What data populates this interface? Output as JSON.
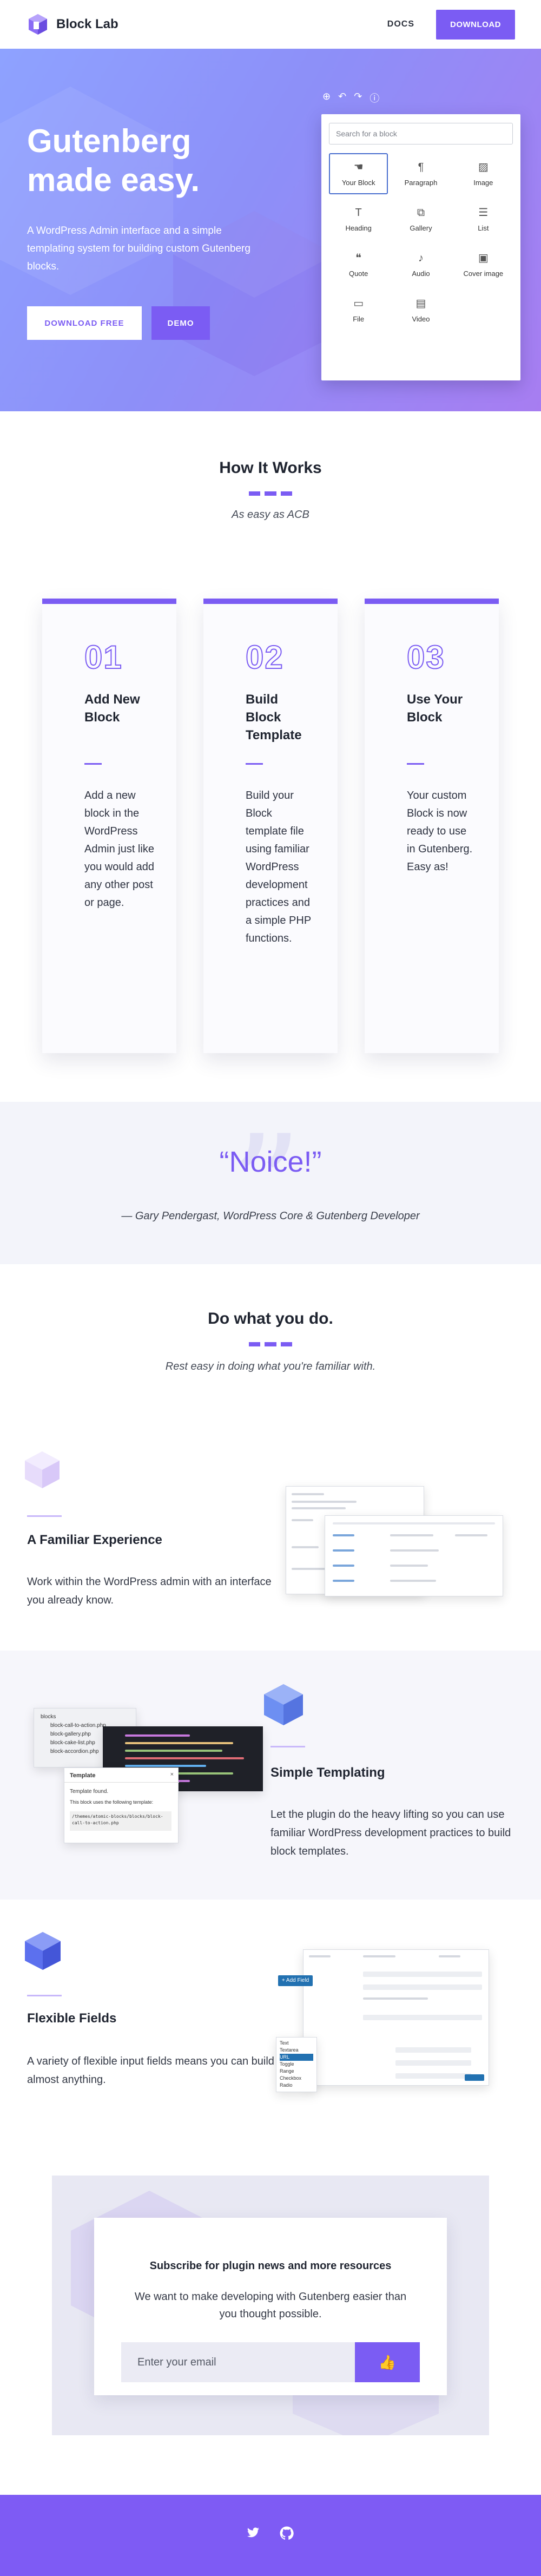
{
  "header": {
    "brand": "Block Lab",
    "nav_docs": "DOCS",
    "nav_download": "DOWNLOAD"
  },
  "hero": {
    "title": "Gutenberg made easy.",
    "subtitle": "A WordPress Admin interface and a simple templating system for building custom Gutenberg blocks.",
    "download_free": "DOWNLOAD FREE",
    "demo": "DEMO",
    "inserter": {
      "search_placeholder": "Search for a block",
      "blocks": [
        {
          "label": "Your Block",
          "icon": "hand-icon"
        },
        {
          "label": "Paragraph",
          "icon": "paragraph-icon"
        },
        {
          "label": "Image",
          "icon": "image-icon"
        },
        {
          "label": "Heading",
          "icon": "heading-icon"
        },
        {
          "label": "Gallery",
          "icon": "gallery-icon"
        },
        {
          "label": "List",
          "icon": "list-icon"
        },
        {
          "label": "Quote",
          "icon": "quote-icon"
        },
        {
          "label": "Audio",
          "icon": "audio-icon"
        },
        {
          "label": "Cover image",
          "icon": "cover-image-icon"
        },
        {
          "label": "File",
          "icon": "file-icon"
        },
        {
          "label": "Video",
          "icon": "video-icon"
        }
      ]
    }
  },
  "how": {
    "title": "How It Works",
    "subtitle": "As easy as ACB",
    "steps": [
      {
        "number": "01",
        "title": "Add New Block",
        "body": "Add a new block in the WordPress Admin just like you would add any other post or page."
      },
      {
        "number": "02",
        "title": "Build Block Template",
        "body": "Build your Block template file using familiar WordPress development practices and a simple PHP functions."
      },
      {
        "number": "03",
        "title": "Use Your Block",
        "body": "Your custom Block is now ready to use in Gutenberg. Easy as!"
      }
    ]
  },
  "quote": {
    "text": "“Noice!”",
    "author": "— Gary Pendergast, WordPress Core & Gutenberg Developer"
  },
  "familiar": {
    "title": "Do what you do.",
    "subtitle": "Rest easy in doing what you're familiar with."
  },
  "features": [
    {
      "title": "A Familiar Experience",
      "text": "Work within the WordPress admin with an interface you already know."
    },
    {
      "title": "Simple Templating",
      "text": "Let the plugin do the heavy lifting so you can use familiar WordPress development practices to build block templates."
    },
    {
      "title": "Flexible Fields",
      "text": "A variety of flexible input fields means you can build almost anything."
    }
  ],
  "templating_shot": {
    "files": [
      "blocks",
      "block-call-to-action.php",
      "block-gallery.php",
      "block-cake-list.php",
      "block-accordion.php"
    ],
    "popup_title": "Template",
    "popup_found": "Template found.",
    "popup_text": "This block uses the following template:",
    "popup_path": "/themes/atomic-blocks/blocks/block-call-to-action.php"
  },
  "fields_shot": {
    "add_field": "+ Add Field",
    "field_types": [
      "Text",
      "Textarea",
      "URL",
      "Toggle",
      "Range",
      "Checkbox",
      "Radio"
    ]
  },
  "subscribe": {
    "title": "Subscribe for plugin news and more resources",
    "text": "We want to make developing with Gutenberg easier than you thought possible.",
    "input_placeholder": "Enter your email",
    "button": "👍"
  },
  "colors": {
    "accent": "#7b5cf3",
    "hero_start": "#8ea2ff",
    "hero_end": "#a77df1"
  }
}
